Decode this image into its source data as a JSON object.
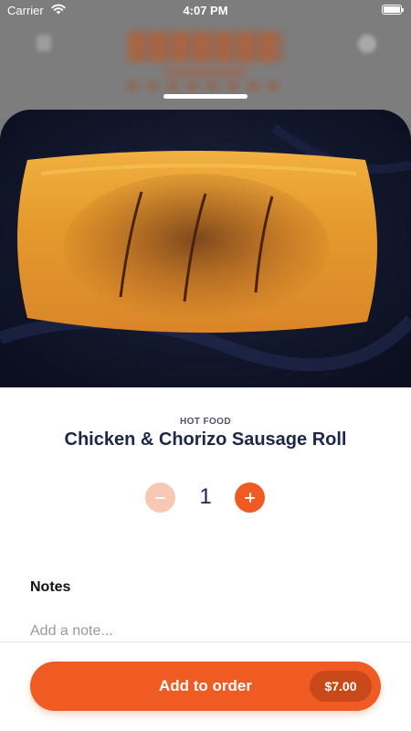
{
  "status_bar": {
    "carrier": "Carrier",
    "time": "4:07 PM"
  },
  "product": {
    "category": "HOT FOOD",
    "name": "Chicken & Chorizo Sausage Roll",
    "image_icon": "sausage-roll-photo"
  },
  "quantity": {
    "value": "1"
  },
  "notes": {
    "label": "Notes",
    "placeholder": "Add a note..."
  },
  "footer": {
    "button_label": "Add to order",
    "price": "$7.00"
  },
  "colors": {
    "accent": "#f05a23",
    "accent_light": "#f7c9b4",
    "price_badge": "#c9491b",
    "title_text": "#1d2748"
  }
}
